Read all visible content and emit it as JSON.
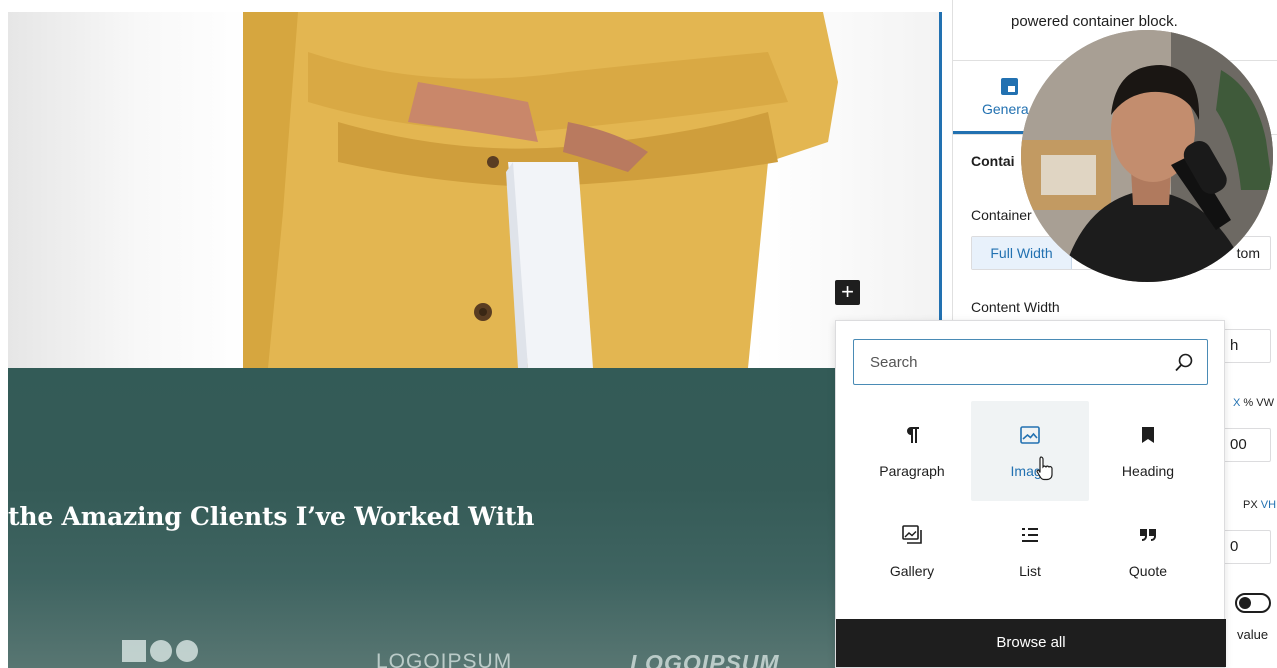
{
  "canvas": {
    "clients_heading": "the Amazing Clients I’ve Worked With",
    "logos": [
      "LOGOIPSUM",
      "LOGOIPSUM"
    ]
  },
  "inserter": {
    "search_placeholder": "Search",
    "blocks": [
      {
        "label": "Paragraph",
        "icon": "paragraph-icon"
      },
      {
        "label": "Image",
        "icon": "image-icon"
      },
      {
        "label": "Heading",
        "icon": "heading-icon"
      },
      {
        "label": "Gallery",
        "icon": "gallery-icon"
      },
      {
        "label": "List",
        "icon": "list-icon"
      },
      {
        "label": "Quote",
        "icon": "quote-icon"
      }
    ],
    "browse_all": "Browse all"
  },
  "sidebar": {
    "block_description": "powered container block.",
    "tab_general": "Genera",
    "panel_title": "Contai",
    "container_label": "Container",
    "container_options": {
      "full": "Full Width",
      "custom": "tom"
    },
    "content_width_label": "Content Width",
    "field_1_value": "h",
    "units_1": {
      "a": "X",
      "b": "%",
      "c": "VW"
    },
    "field_2_value": "00",
    "units_2": {
      "a": "PX",
      "b": "VH"
    },
    "field_3_value": "0",
    "value_label": "value"
  },
  "colors": {
    "accent": "#2271b1",
    "clients_bg": "#335b57",
    "inserter_footer": "#1e1e1e",
    "jacket": "#e3b651"
  }
}
